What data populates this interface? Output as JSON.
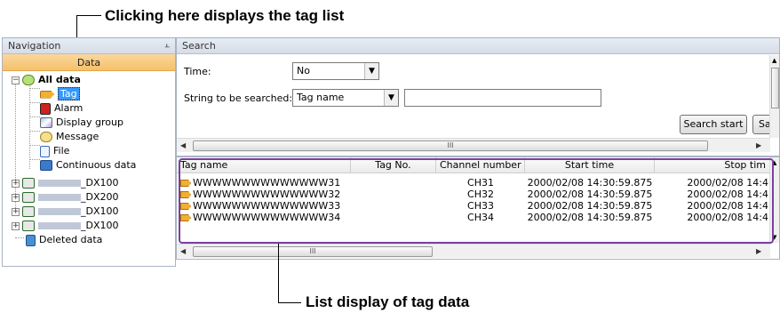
{
  "callouts": {
    "top": "Clicking here displays the tag list",
    "bottom": "List display of tag data"
  },
  "navigation": {
    "title": "Navigation",
    "pin_icon": "pin-icon",
    "header": "Data",
    "items": [
      {
        "label": "All data",
        "icon": "database-icon"
      },
      {
        "label": "Tag",
        "icon": "tag-icon"
      },
      {
        "label": "Alarm",
        "icon": "alarm-icon"
      },
      {
        "label": "Display group",
        "icon": "display-group-icon"
      },
      {
        "label": "Message",
        "icon": "message-icon"
      },
      {
        "label": "File",
        "icon": "file-icon"
      },
      {
        "label": "Continuous data",
        "icon": "continuous-data-icon"
      },
      {
        "label": "_DX100",
        "icon": "device-icon"
      },
      {
        "label": "_DX200",
        "icon": "device-icon"
      },
      {
        "label": "_DX100",
        "icon": "device-icon"
      },
      {
        "label": "_DX100",
        "icon": "device-icon"
      },
      {
        "label": "Deleted data",
        "icon": "trash-icon"
      }
    ]
  },
  "search": {
    "title": "Search",
    "time_label": "Time:",
    "time_value": "No",
    "string_label": "String to be searched:",
    "string_type_value": "Tag name",
    "string_input_value": "",
    "search_start_label": "Search start",
    "second_button_label": "Sa",
    "scroll_thumb": "III"
  },
  "list": {
    "columns": [
      "Tag name",
      "Tag No.",
      "Channel number",
      "Start time",
      "Stop tim"
    ],
    "rows": [
      {
        "tag_name": "WWWWWWWWWWWWWW31",
        "tag_no": "",
        "channel": "CH31",
        "start": "2000/02/08 14:30:59.875",
        "stop": "2000/02/08 14:4"
      },
      {
        "tag_name": "WWWWWWWWWWWWWW32",
        "tag_no": "",
        "channel": "CH32",
        "start": "2000/02/08 14:30:59.875",
        "stop": "2000/02/08 14:4"
      },
      {
        "tag_name": "WWWWWWWWWWWWWW33",
        "tag_no": "",
        "channel": "CH33",
        "start": "2000/02/08 14:30:59.875",
        "stop": "2000/02/08 14:4"
      },
      {
        "tag_name": "WWWWWWWWWWWWWW34",
        "tag_no": "",
        "channel": "CH34",
        "start": "2000/02/08 14:30:59.875",
        "stop": "2000/02/08 14:4"
      }
    ],
    "scroll_thumb": "III"
  },
  "colors": {
    "selection": "#3399ff",
    "nav_header": "#f5c06b",
    "highlight_outline": "#7b3fa0"
  }
}
